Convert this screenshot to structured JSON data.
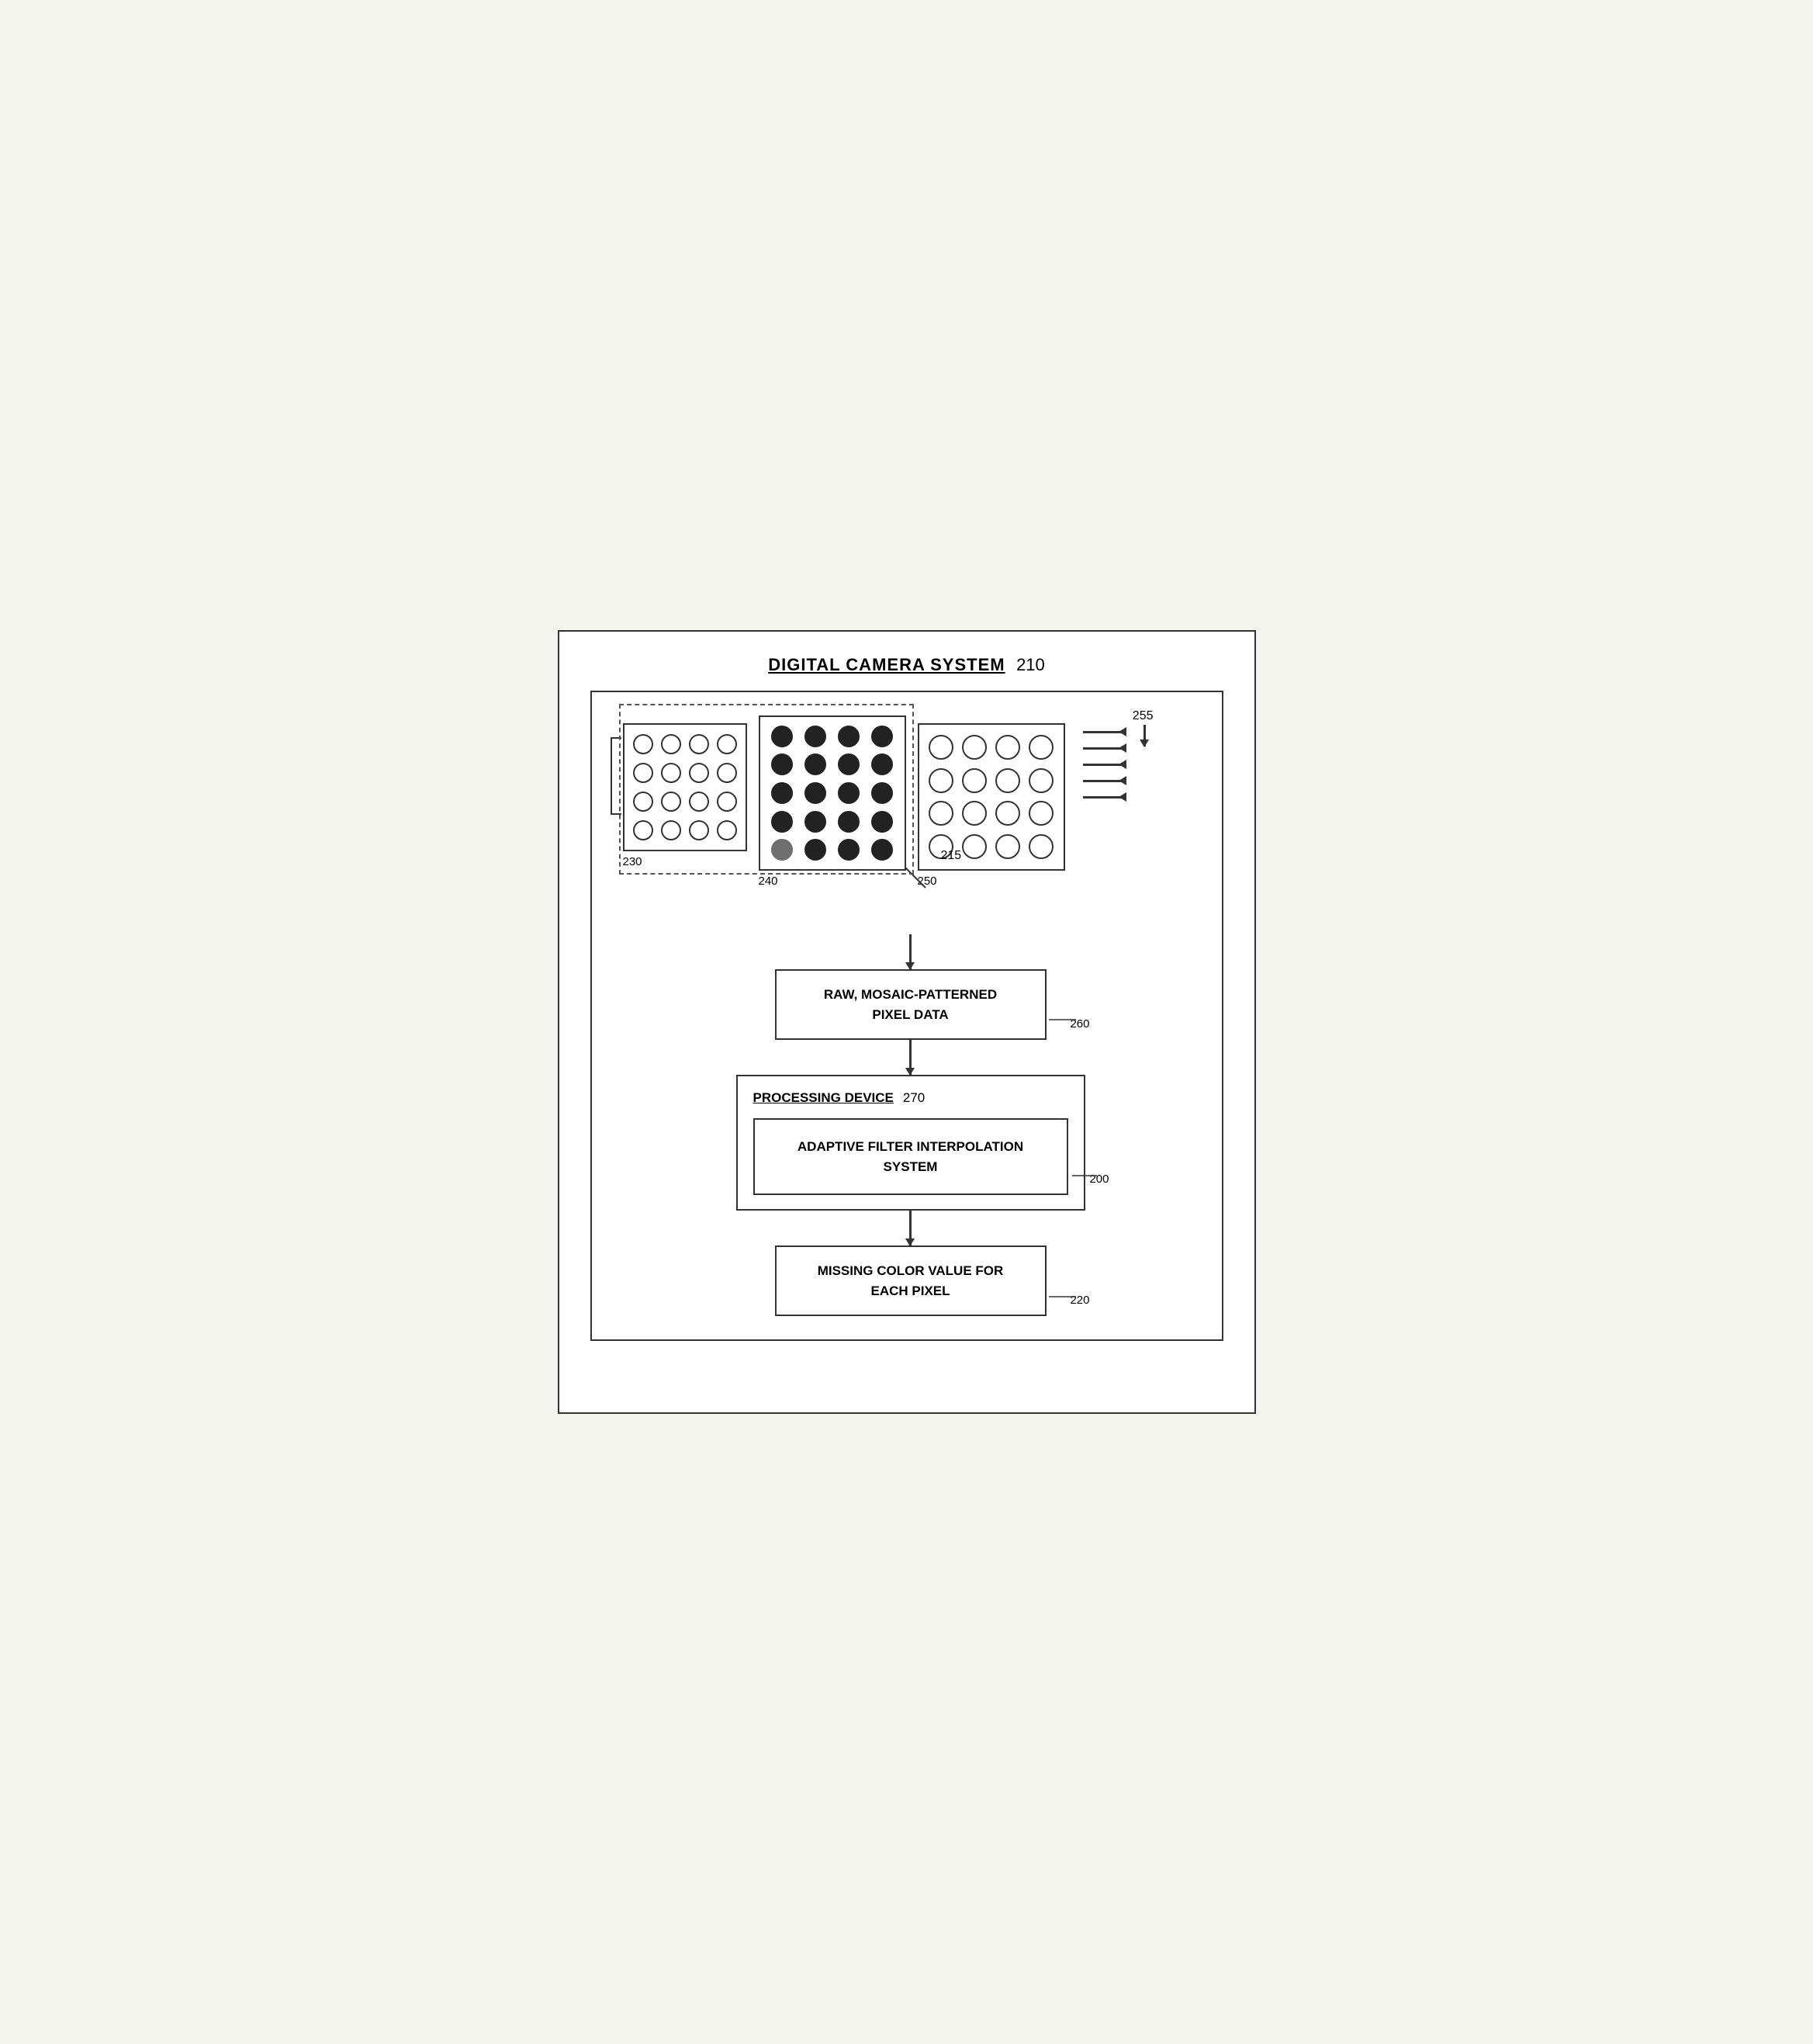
{
  "page": {
    "background": "#ffffff"
  },
  "diagram": {
    "title": "DIGITAL CAMERA SYSTEM",
    "title_num": "210",
    "ref_255": "255",
    "ref_215": "215",
    "ref_230": "230",
    "ref_240": "240",
    "ref_250": "250",
    "ref_260": "260",
    "ref_270": "270",
    "ref_200": "200",
    "ref_220": "220",
    "box_raw_label": "RAW, MOSAIC-PATTERNED PIXEL DATA",
    "box_proc_title": "PROCESSING DEVICE",
    "box_afis_label": "ADAPTIVE FILTER INTERPOLATION SYSTEM",
    "box_missing_label": "MISSING COLOR VALUE FOR EACH PIXEL"
  }
}
